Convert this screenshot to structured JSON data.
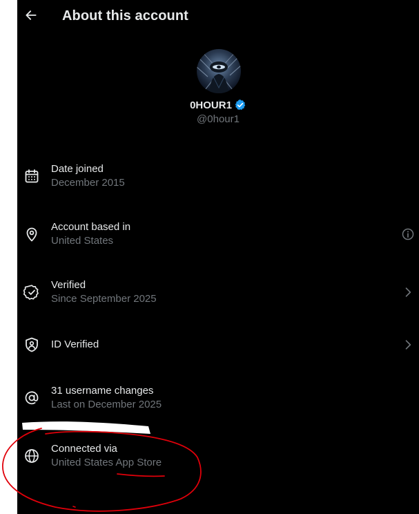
{
  "header": {
    "title": "About this account",
    "back_icon": "arrow-left-icon"
  },
  "profile": {
    "display_name": "0HOUR1",
    "handle": "@0hour1",
    "verified_badge_color": "#1d9bf0"
  },
  "rows": [
    {
      "icon": "calendar-icon",
      "label": "Date joined",
      "sub": "December 2015"
    },
    {
      "icon": "location-pin-icon",
      "label": "Account based in",
      "sub": "United States",
      "trail": "info-icon"
    },
    {
      "icon": "verified-check-icon",
      "label": "Verified",
      "sub": "Since September 2025",
      "trail": "chevron-right-icon"
    },
    {
      "icon": "id-shield-icon",
      "label": "ID Verified",
      "sub": "",
      "trail": "chevron-right-icon"
    },
    {
      "icon": "at-sign-icon",
      "label": "31 username changes",
      "sub": "Last on December 2025"
    },
    {
      "icon": "globe-icon",
      "label": "Connected via",
      "sub": "United States App Store"
    }
  ],
  "colors": {
    "background": "#000000",
    "primary_text": "#e7e9ea",
    "secondary_text": "#71767b",
    "annotation": "#e0000a"
  }
}
